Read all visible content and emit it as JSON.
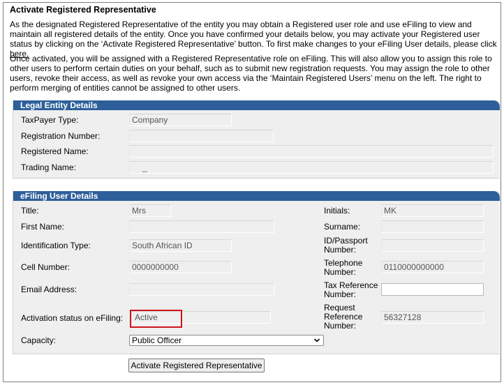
{
  "page": {
    "title": "Activate Registered Representative",
    "intro_text": "As the designated Registered Representative of the entity you may obtain a Registered user role and use eFiling to view and maintain all registered details of the entity. Once you have confirmed your details below, you may activate your Registered user status by clicking on the ‘Activate Registered Representative’ button. To first make changes to your eFiling User details, please click ",
    "intro_link": "here.",
    "info_text": "Once activated, you will be assigned with a Registered Representative role on eFiling. This will also allow you to assign this role to other users to perform certain duties on your behalf, such as to submit new registration requests. You may assign the role to other users, revoke their access, as well as revoke your own access via the ‘Maintain Registered Users’ menu on the left. The right to perform merging of entities cannot be assigned to other users."
  },
  "legal_entity": {
    "header": "Legal Entity Details",
    "taxpayer_type_label": "TaxPayer Type:",
    "taxpayer_type_value": "Company",
    "registration_number_label": "Registration Number:",
    "registration_number_value": "",
    "registered_name_label": "Registered Name:",
    "registered_name_value": "",
    "trading_name_label": "Trading Name:",
    "trading_name_value": "_"
  },
  "efiling_user": {
    "header": "eFiling User Details",
    "title_label": "Title:",
    "title_value": "Mrs",
    "initials_label": "Initials:",
    "initials_value": "MK",
    "first_name_label": "First Name:",
    "first_name_value": "",
    "surname_label": "Surname:",
    "surname_value": "",
    "id_type_label": "Identification Type:",
    "id_type_value": "South African ID",
    "id_number_label_1": "ID/Passport",
    "id_number_label_2": "Number:",
    "id_number_value": "",
    "cell_label": "Cell Number:",
    "cell_value": "0000000000",
    "telephone_label_1": "Telephone",
    "telephone_label_2": "Number:",
    "telephone_value": "0110000000000",
    "email_label": "Email Address:",
    "email_value": "",
    "tax_ref_label_1": "Tax Reference",
    "tax_ref_label_2": "Number:",
    "tax_ref_value": "",
    "activation_label": "Activation status on eFiling:",
    "activation_value": "Active",
    "request_ref_label_1": "Request",
    "request_ref_label_2": "Reference",
    "request_ref_label_3": "Number:",
    "request_ref_value": "56327128",
    "capacity_label": "Capacity:",
    "capacity_value": "Public Officer"
  },
  "actions": {
    "activate_button": "Activate Registered Representative"
  },
  "colors": {
    "panel_header": "#2d5f9a",
    "highlight": "#d0141b"
  }
}
